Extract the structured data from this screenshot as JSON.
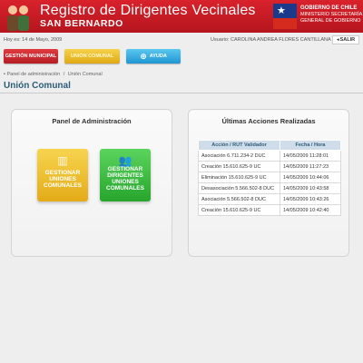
{
  "header": {
    "title": "Registro de Dirigentes Vecinales",
    "subtitle": "SAN BERNARDO",
    "gov_lines": [
      "GOBIERNO DE CHILE",
      "MINISTERIO SECRETARÍA",
      "GENERAL DE GOBIERNO"
    ]
  },
  "infobar": {
    "date": "Hoy es: 14 de Mayo, 2009",
    "user": "Usuario: CAROLINA ANDREA FLORES CANTILLANA",
    "logout_label": "SALIR"
  },
  "nav": [
    {
      "label": "GESTIÓN MUNICIPAL"
    },
    {
      "label": "UNIÓN COMUNAL"
    },
    {
      "label": "AYUDA"
    }
  ],
  "breadcrumb": [
    "Panel de administración",
    "Unión Comunal"
  ],
  "page_title": "Unión Comunal",
  "admin_panel": {
    "title": "Panel de Administración",
    "tiles": [
      {
        "label": "GESTIONAR UNIONES COMUNALES",
        "icon": "building-icon"
      },
      {
        "label": "GESTIONAR DIRIGENTES UNIONES COMUNALES",
        "icon": "people-icon"
      }
    ]
  },
  "actions_panel": {
    "title": "Últimas Acciones Realizadas",
    "columns": [
      "Acción / RUT Validador",
      "Fecha / Hora"
    ],
    "rows": [
      [
        "Asociación 6.711.234-2 DUC",
        "14/05/2009 11:28:01"
      ],
      [
        "Creación 15.610.625-9 UC",
        "14/05/2009 11:27:23"
      ],
      [
        "Eliminación 15.610.625-9 UC",
        "14/05/2009 10:44:06"
      ],
      [
        "Desasociación 5.566.502-8 DUC",
        "14/05/2009 10:43:58"
      ],
      [
        "Asociación 5.566.502-8 DUC",
        "14/05/2009 10:43:26"
      ],
      [
        "Creación 15.610.625-9 UC",
        "14/05/2009 10:42:40"
      ]
    ]
  },
  "colors": {
    "header_red": "#c81b24",
    "title_blue": "#2e5d7a",
    "nav_red": "#c8262d",
    "nav_yellow": "#eebf2e",
    "nav_blue": "#36aee2",
    "tile_yellow": "#efc236",
    "tile_green": "#3cbf40",
    "table_header_bg": "#cfdcea"
  }
}
